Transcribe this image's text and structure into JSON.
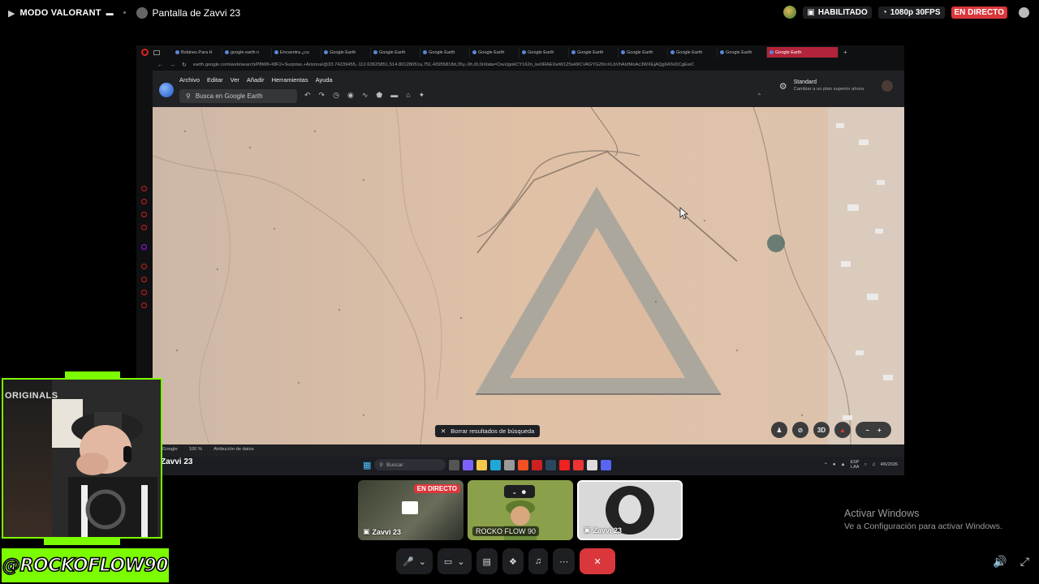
{
  "topbar": {
    "mode_label": "MODO VALORANT",
    "screen_title": "Pantalla de Zavvi 23",
    "enabled_label": "HABILITADO",
    "quality_label": "1080p 30FPS",
    "live_label": "EN DIRECTO"
  },
  "browser": {
    "tabs": [
      "Bobines Para H",
      "google earth n",
      "Encuentra ¿cu",
      "Google Earth",
      "Google Earth",
      "Google Earth",
      "Google Earth",
      "Google Earth",
      "Google Earth",
      "Google Earth",
      "Google Earth",
      "Google Earth",
      "Google Earth"
    ],
    "url": "earth.google.com/web/search/P8W8+WF2+Surprise,+Arizona/@33.74239455,-112.63625851,514.80128051a,751.43955818d,35y,-0h,0t,0r/data=CiwiJgokCY162n_ke0RAEXwW125wWCVAGYGZKnXLbVhAIdMoAc3WXEjAQgIIATeDCgEwC"
  },
  "google_earth": {
    "menu": [
      "Archivo",
      "Editar",
      "Ver",
      "Añadir",
      "Herramientas",
      "Ayuda"
    ],
    "search_placeholder": "Busca en Google Earth",
    "map_style_title": "Standard",
    "map_style_subtitle": "Cambiar a un plan superior ahora",
    "clear_results_label": "Borrar resultados de búsqueda",
    "view_3d_label": "3D",
    "footer_google": "Google",
    "footer_zoom": "100 %",
    "footer_attribution": "Atribución de datos",
    "streamer_overlay_name": "Zavvi 23"
  },
  "taskbar": {
    "search_placeholder": "Buscar",
    "lang_line1": "ESP",
    "lang_line2": "LAA",
    "date": "4/6/2026"
  },
  "webcam": {
    "poster_text": "ORIGINALS",
    "handle": "@ROCKOFLOW90"
  },
  "participants": [
    {
      "name": "Zavvi 23",
      "badge": "EN DIRECTO"
    },
    {
      "name": "ROCKO FLOW 90"
    },
    {
      "name": "Zavvi 23"
    }
  ],
  "windows_activation": {
    "title": "Activar Windows",
    "subtitle": "Ve a Configuración para activar Windows."
  },
  "colors": {
    "live_red": "#da373c",
    "streamer_green": "#7cfc00",
    "desert": "#d8b8a0"
  }
}
